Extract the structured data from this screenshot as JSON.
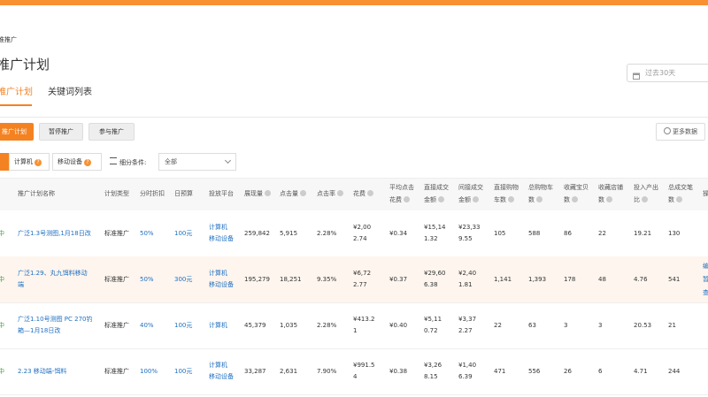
{
  "breadcrumb": "准推广",
  "page_title": "推广计划",
  "date_filter": "过去30天",
  "tabs": [
    "推广计划",
    "关键词列表"
  ],
  "toolbar": {
    "new_label": "推广计划",
    "pause_label": "暂停推广",
    "join_label": "参与推广",
    "more_label": "更多数据"
  },
  "device_filter": {
    "pc": "计算机",
    "mobile": "移动设备"
  },
  "segment": {
    "label": "细分条件:",
    "value": "全部"
  },
  "headers": [
    [
      "推广计划名称"
    ],
    [
      "计划类型"
    ],
    [
      "分时折扣"
    ],
    [
      "日预算"
    ],
    [
      "投放平台"
    ],
    [
      "展现量"
    ],
    [
      "点击量"
    ],
    [
      "点击率"
    ],
    [
      "花费"
    ],
    [
      "平均点击",
      "花费"
    ],
    [
      "直接成交",
      "金额"
    ],
    [
      "间接成交",
      "金额"
    ],
    [
      "直接购物",
      "车数"
    ],
    [
      "总购物车",
      "数"
    ],
    [
      "收藏宝贝",
      "数"
    ],
    [
      "收藏店铺",
      "数"
    ],
    [
      "投入产出",
      "比"
    ],
    [
      "总成交笔",
      "数"
    ],
    [
      "操"
    ]
  ],
  "rows": [
    {
      "status": "中",
      "name": [
        "广泛1.3号测图,1月18日改"
      ],
      "type": "标准推广",
      "discount": "50%",
      "budget": "100元",
      "platform": [
        "计算机",
        "移动设备"
      ],
      "impressions": "259,842",
      "clicks": "5,915",
      "ctr": "2.28%",
      "cost": [
        "¥2,00",
        "2.74"
      ],
      "cpc": "¥0.34",
      "direct": [
        "¥15,14",
        "1.32"
      ],
      "indirect": [
        "¥23,33",
        "9.55"
      ],
      "direct_cart": "105",
      "total_cart": "588",
      "fav_item": "86",
      "fav_shop": "22",
      "roi": "19.21",
      "orders": "130",
      "ops": []
    },
    {
      "status": "中",
      "name": [
        "广泛1.29、丸九饵料移动",
        "端"
      ],
      "type": "标准推广",
      "discount": "50%",
      "budget": "300元",
      "platform": [
        "计算机",
        "移动设备"
      ],
      "impressions": "195,279",
      "clicks": "18,251",
      "ctr": "9.35%",
      "cost": [
        "¥6,72",
        "2.77"
      ],
      "cpc": "¥0.37",
      "direct": [
        "¥29,60",
        "6.38"
      ],
      "indirect": [
        "¥2,40",
        "1.81"
      ],
      "direct_cart": "1,141",
      "total_cart": "1,393",
      "fav_item": "178",
      "fav_shop": "48",
      "roi": "4.76",
      "orders": "541",
      "ops": [
        "编",
        "暂",
        "查"
      ]
    },
    {
      "status": "中",
      "name": [
        "广泛1.10号测图 PC 270钓",
        "箱—1月18日改"
      ],
      "type": "标准推广",
      "discount": "40%",
      "budget": "100元",
      "platform": [
        "计算机"
      ],
      "impressions": "45,379",
      "clicks": "1,035",
      "ctr": "2.28%",
      "cost": [
        "¥413.2",
        "1"
      ],
      "cpc": "¥0.40",
      "direct": [
        "¥5,11",
        "0.72"
      ],
      "indirect": [
        "¥3,37",
        "2.27"
      ],
      "direct_cart": "22",
      "total_cart": "63",
      "fav_item": "3",
      "fav_shop": "3",
      "roi": "20.53",
      "orders": "21",
      "ops": []
    },
    {
      "status": "中",
      "name": [
        "2.23 移动端-饵料"
      ],
      "type": "标准推广",
      "discount": "100%",
      "budget": "100元",
      "platform": [
        "计算机",
        "移动设备"
      ],
      "impressions": "33,287",
      "clicks": "2,631",
      "ctr": "7.90%",
      "cost": [
        "¥991.5",
        "4"
      ],
      "cpc": "¥0.38",
      "direct": [
        "¥3,26",
        "8.15"
      ],
      "indirect": [
        "¥1,40",
        "6.39"
      ],
      "direct_cart": "471",
      "total_cart": "556",
      "fav_item": "26",
      "fav_shop": "6",
      "roi": "4.71",
      "orders": "244",
      "ops": []
    }
  ]
}
